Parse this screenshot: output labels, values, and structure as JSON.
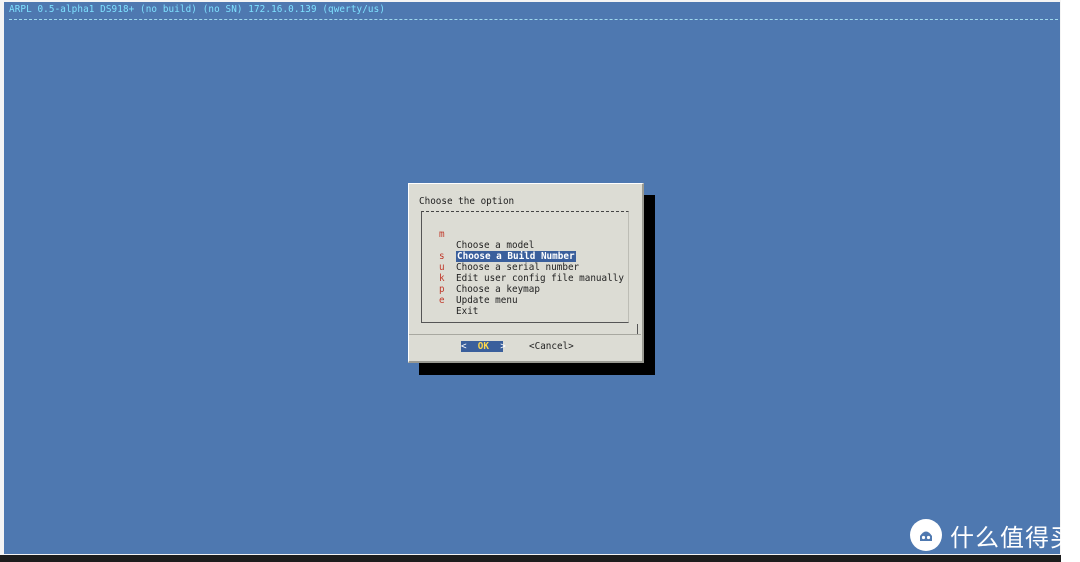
{
  "backtitle": "ARPL 0.5-alpha1 DS918+ (no build) (no SN) 172.16.0.139 (qwerty/us)",
  "dialog": {
    "title": "Choose the option",
    "items": [
      {
        "key": "m",
        "label": "Choose a model"
      },
      {
        "key": "",
        "label": "Choose a Build Number"
      },
      {
        "key": "s",
        "label": "Choose a serial number"
      },
      {
        "key": "u",
        "label": "Edit user config file manually"
      },
      {
        "key": "k",
        "label": "Choose a keymap"
      },
      {
        "key": "p",
        "label": "Update menu"
      },
      {
        "key": "e",
        "label": "Exit"
      }
    ],
    "selected_index": 1,
    "ok_left": "<  ",
    "ok_hot": "OK",
    "ok_right": "  >",
    "cancel_label": "<Cancel>"
  },
  "colors": {
    "terminal_background": "#4e78b0",
    "dialog_background": "#dcdcd4",
    "hotkey": "#c03a2b",
    "selection": "#3a5f9c"
  },
  "watermark": {
    "text": "什么值得买",
    "icon": "smzdm-logo-icon"
  }
}
